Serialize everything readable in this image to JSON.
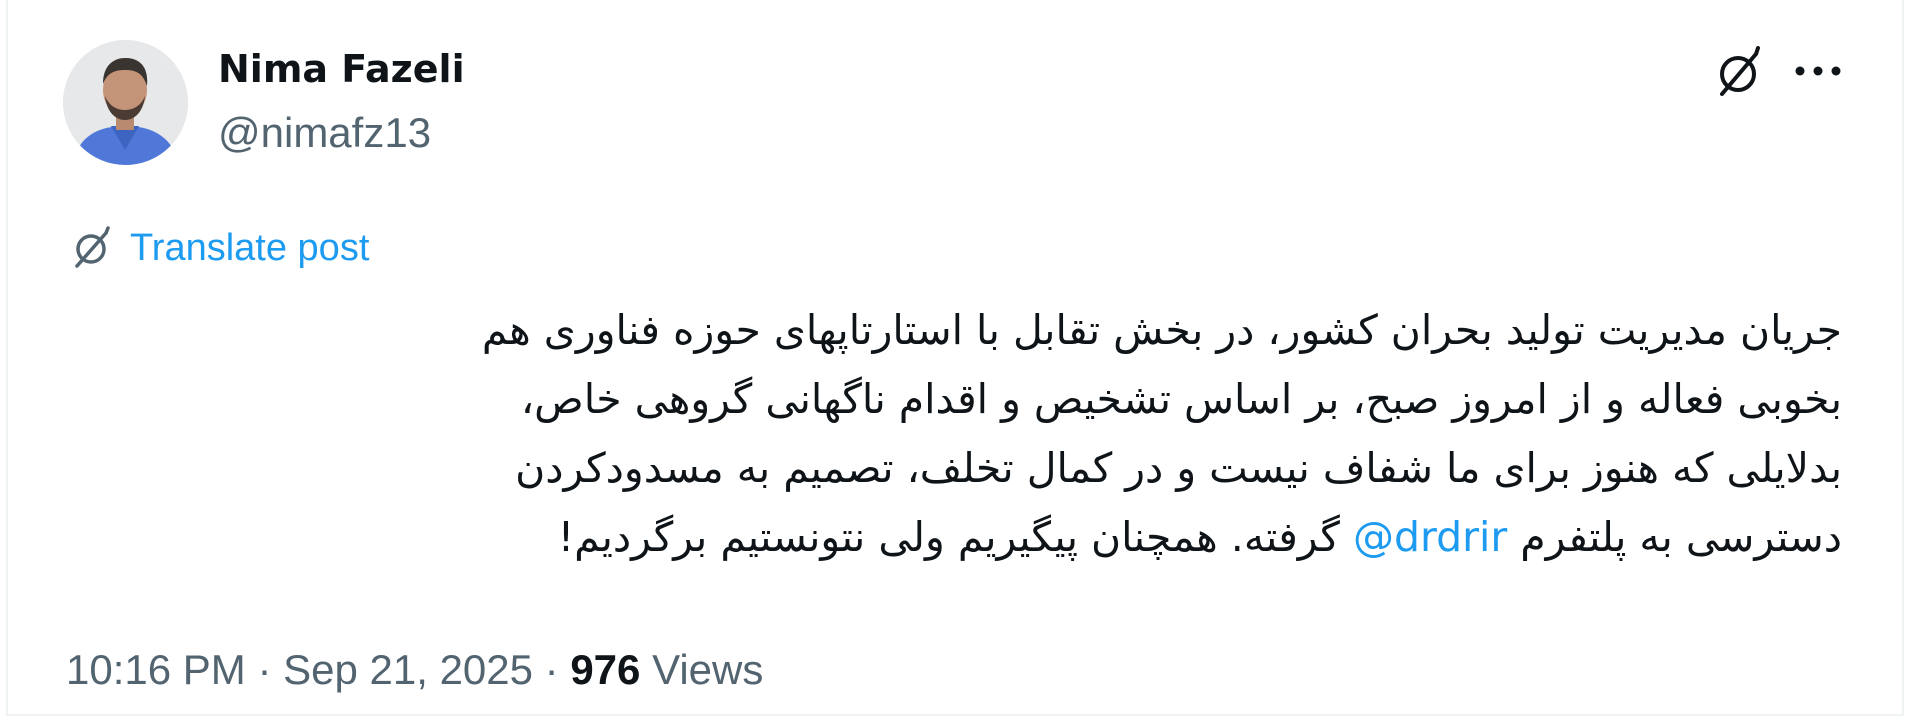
{
  "author": {
    "name": "Nima Fazeli",
    "handle": "@nimafz13"
  },
  "icons": {
    "translate": "translate-icon",
    "more": "more-options-icon",
    "avatar": "profile-photo"
  },
  "translate": {
    "label": "Translate post"
  },
  "post": {
    "lines": [
      {
        "text": "جریان مدیریت تولید بحران کشور، در بخش تقابل با استارتاپهای حوزه فناوری هم"
      },
      {
        "text": "بخوبی فعاله و از امروز صبح، بر اساس تشخیص و اقدام ناگهانی گروهی خاص،"
      },
      {
        "text": "بدلایلی که هنوز برای ما شفاف نیست و در کمال تخلف، تصمیم به مسدودکردن"
      }
    ],
    "last_line_before": "دسترسی به پلتفرم ",
    "mention": "@drdrir",
    "last_line_after": " گرفته. همچنان پیگیریم ولی نتونستیم برگردیم!"
  },
  "meta": {
    "time": "10:16 PM",
    "separator": " · ",
    "date": "Sep 21, 2025",
    "views_count": "976",
    "views_label": " Views"
  },
  "colors": {
    "text_primary": "#0f1419",
    "text_secondary": "#536471",
    "link": "#1d9bf0"
  }
}
